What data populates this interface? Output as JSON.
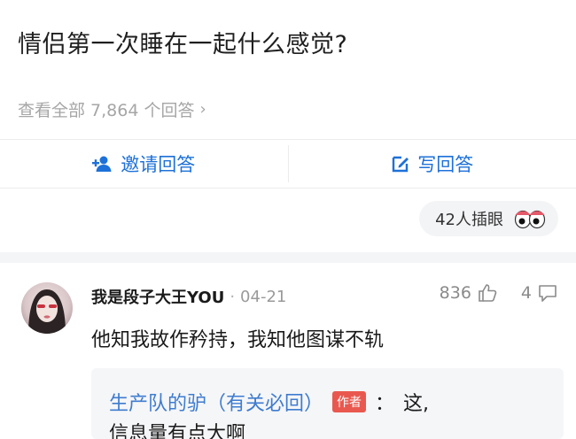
{
  "question": {
    "title": "情侣第一次睡在一起什么感觉?",
    "view_all": "查看全部 7,864 个回答",
    "chevron": "›"
  },
  "actions": {
    "invite_label": "邀请回答",
    "write_label": "写回答",
    "invite_icon": "add-user-icon",
    "write_icon": "edit-icon"
  },
  "watchers": {
    "label": "42人插眼",
    "icon": "eyes-icon"
  },
  "answer": {
    "author": "我是段子大王YOU",
    "separator": "·",
    "date": "04-21",
    "likes": "836",
    "comments": "4",
    "text": "他知我故作矜持，我知他图谋不轨",
    "reply": {
      "name": "生产队的驴（有关必回）",
      "badge": "作者",
      "colon": "：",
      "text_line1": "这,",
      "text_line2": "信息量有点大啊"
    }
  },
  "colors": {
    "accent_blue": "#1e71d8",
    "reply_name": "#3f7ccf",
    "author_badge": "#e9584f",
    "muted": "#a6a6a6"
  }
}
